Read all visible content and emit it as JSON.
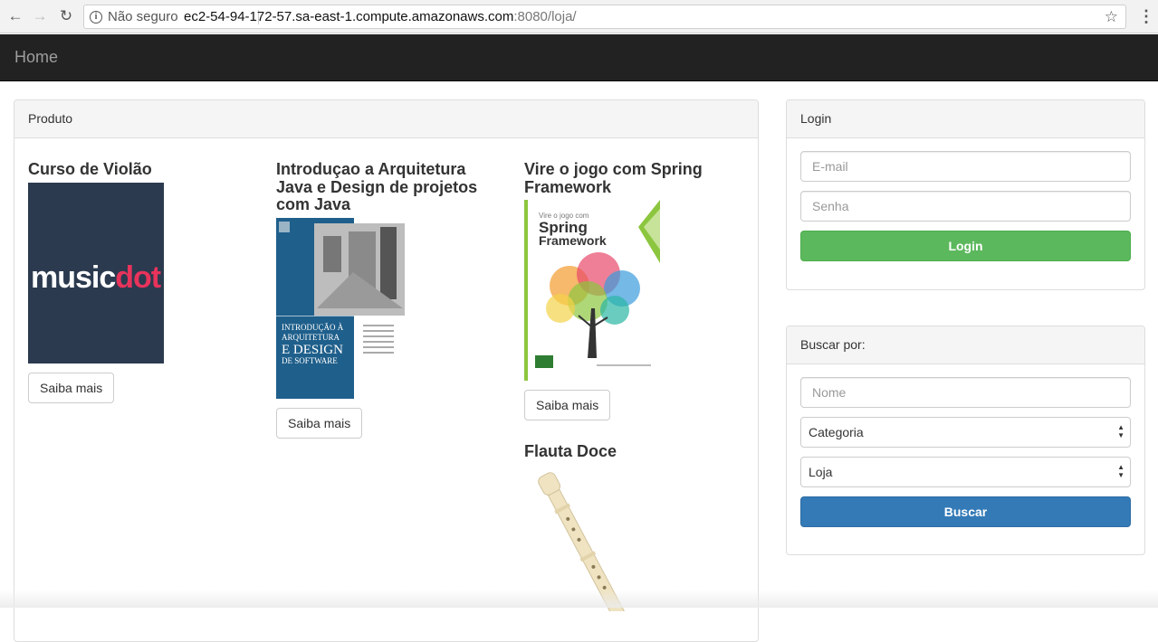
{
  "browser": {
    "security_label": "Não seguro",
    "url_host": "ec2-54-94-172-57.sa-east-1.compute.amazonaws.com",
    "url_rest": ":8080/loja/"
  },
  "navbar": {
    "brand": "Home"
  },
  "products_panel": {
    "heading": "Produto",
    "items": [
      {
        "title": "Curso de Violão",
        "button": "Saiba mais",
        "image_logo_a": "music",
        "image_logo_b": "dot"
      },
      {
        "title": "Introduçao a Arquitetura Java e Design de projetos com Java",
        "button": "Saiba mais"
      },
      {
        "title": "Vire o jogo com Spring Framework",
        "button": "Saiba mais"
      },
      {
        "title": "Flauta Doce"
      }
    ]
  },
  "login_panel": {
    "heading": "Login",
    "email_placeholder": "E-mail",
    "password_placeholder": "Senha",
    "submit": "Login"
  },
  "search_panel": {
    "heading": "Buscar por:",
    "name_placeholder": "Nome",
    "category_selected": "Categoria",
    "store_selected": "Loja",
    "submit": "Buscar"
  },
  "colors": {
    "navbar_bg": "#222222",
    "success": "#5cb85c",
    "primary": "#337ab7"
  }
}
